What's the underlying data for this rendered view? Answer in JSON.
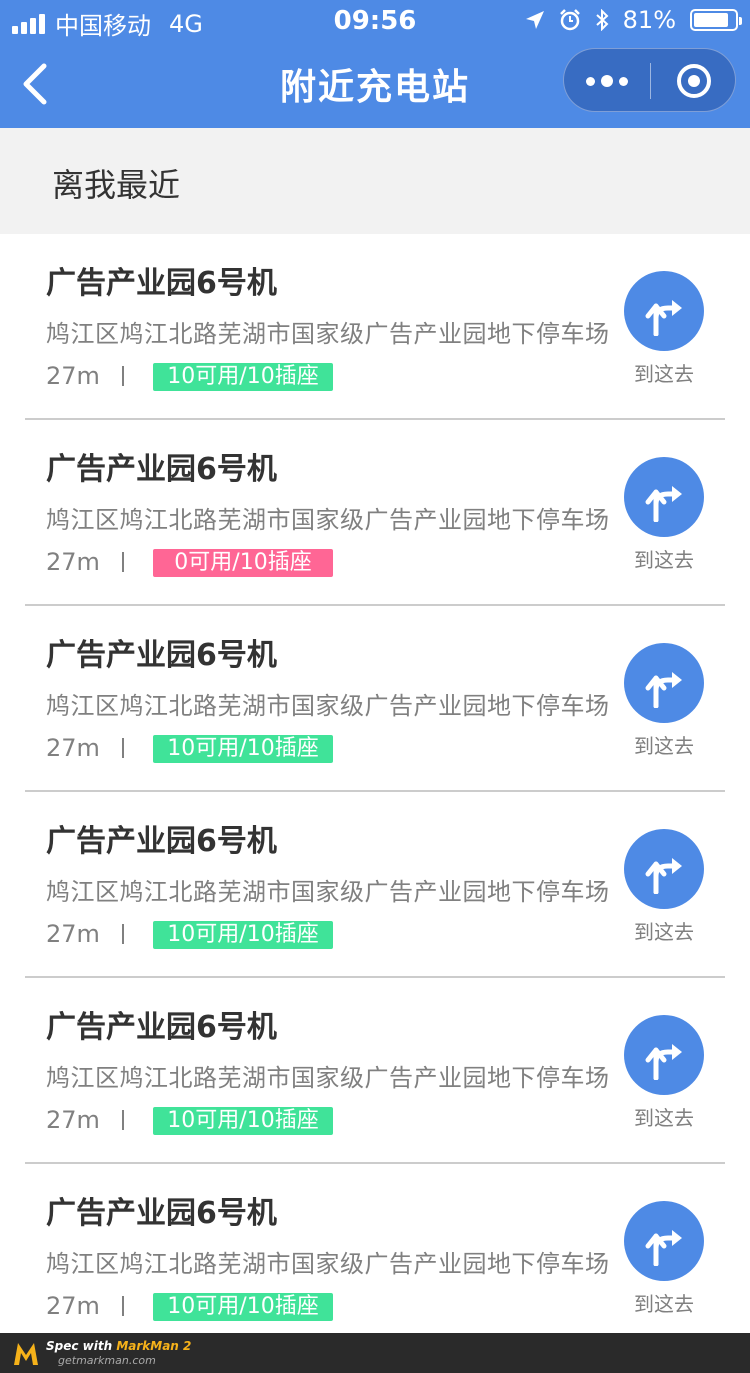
{
  "status_bar": {
    "carrier": "中国移动",
    "network": "4G",
    "time": "09:56",
    "battery": "81%",
    "battery_level": 0.81
  },
  "nav": {
    "title": "附近充电站"
  },
  "section": {
    "title": "离我最近"
  },
  "colors": {
    "primary": "#4e8ae5",
    "title_text": "#333333",
    "secondary_text": "#808080",
    "available_badge": "#40e399",
    "full_badge": "#ff6695",
    "divider": "#cccccc"
  },
  "stations": [
    {
      "name": "广告产业园6号机",
      "address": "鸠江区鸠江北路芜湖市国家级广告产业园地下停车场",
      "distance": "27m",
      "availability": "10可用/10插座",
      "status": "available",
      "go_label": "到这去"
    },
    {
      "name": "广告产业园6号机",
      "address": "鸠江区鸠江北路芜湖市国家级广告产业园地下停车场",
      "distance": "27m",
      "availability": "0可用/10插座",
      "status": "full",
      "go_label": "到这去"
    },
    {
      "name": "广告产业园6号机",
      "address": "鸠江区鸠江北路芜湖市国家级广告产业园地下停车场",
      "distance": "27m",
      "availability": "10可用/10插座",
      "status": "available",
      "go_label": "到这去"
    },
    {
      "name": "广告产业园6号机",
      "address": "鸠江区鸠江北路芜湖市国家级广告产业园地下停车场",
      "distance": "27m",
      "availability": "10可用/10插座",
      "status": "available",
      "go_label": "到这去"
    },
    {
      "name": "广告产业园6号机",
      "address": "鸠江区鸠江北路芜湖市国家级广告产业园地下停车场",
      "distance": "27m",
      "availability": "10可用/10插座",
      "status": "available",
      "go_label": "到这去"
    },
    {
      "name": "广告产业园6号机",
      "address": "鸠江区鸠江北路芜湖市国家级广告产业园地下停车场",
      "distance": "27m",
      "availability": "10可用/10插座",
      "status": "available",
      "go_label": "到这去"
    }
  ],
  "footer": {
    "spec_prefix": "Spec with ",
    "brand": "MarkMan 2",
    "url": "getmarkman.com"
  }
}
